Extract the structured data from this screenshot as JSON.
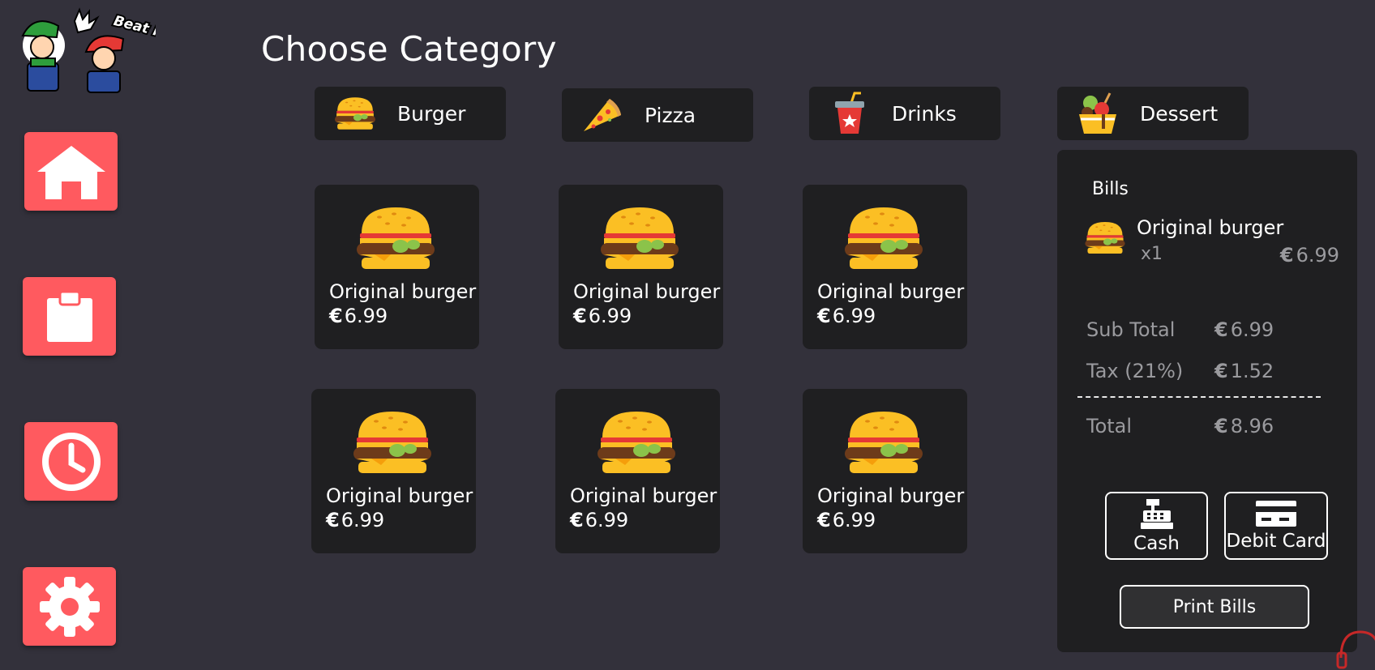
{
  "logo": {
    "caption": "Beat it!"
  },
  "nav": [
    {
      "icon": "home-icon"
    },
    {
      "icon": "clipboard-icon"
    },
    {
      "icon": "clock-icon"
    },
    {
      "icon": "gear-icon"
    }
  ],
  "page_title": "Choose Category",
  "categories": [
    {
      "label": "Burger",
      "icon": "burger-icon"
    },
    {
      "label": "Pizza",
      "icon": "pizza-icon"
    },
    {
      "label": "Drinks",
      "icon": "drink-icon"
    },
    {
      "label": "Dessert",
      "icon": "dessert-icon"
    }
  ],
  "products": [
    {
      "name": "Original burger",
      "currency": "€",
      "price": "6.99"
    },
    {
      "name": "Original burger",
      "currency": "€",
      "price": "6.99"
    },
    {
      "name": "Original burger",
      "currency": "€",
      "price": "6.99"
    },
    {
      "name": "Original burger",
      "currency": "€",
      "price": "6.99"
    },
    {
      "name": "Original burger",
      "currency": "€",
      "price": "6.99"
    },
    {
      "name": "Original burger",
      "currency": "€",
      "price": "6.99"
    }
  ],
  "bills": {
    "title": "Bills",
    "items": [
      {
        "name": "Original burger",
        "qty": "x1",
        "currency": "€",
        "price": "6.99"
      }
    ],
    "subtotal_label": "Sub Total",
    "subtotal_value": "6.99",
    "tax_label": "Tax (21%)",
    "tax_value": "1.52",
    "total_label": "Total",
    "total_value": "8.96",
    "currency": "€",
    "cash_label": "Cash",
    "debit_label": "Debit Card",
    "print_label": "Print Bills"
  },
  "colors": {
    "background": "#33313b",
    "panel": "#1f1f21",
    "accent": "#ff5a5f",
    "muted_text": "#9a9a9e"
  }
}
